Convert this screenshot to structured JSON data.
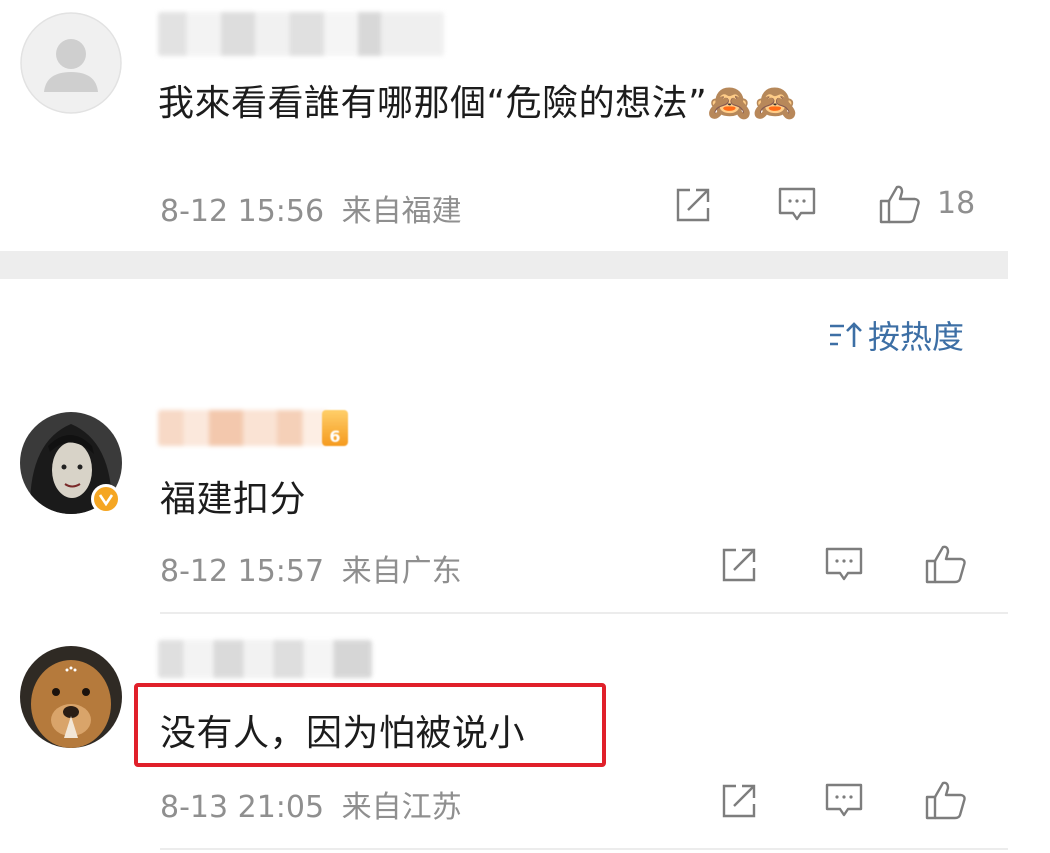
{
  "sort": {
    "label": "按热度"
  },
  "comments": [
    {
      "text": "我來看看誰有哪那個“危險的想法”🙈🙈",
      "time": "8-12 15:56",
      "location": "来自福建",
      "like_count": "18"
    },
    {
      "text": "福建扣分",
      "time": "8-12 15:57",
      "location": "来自广东",
      "like_count": ""
    },
    {
      "text": "没有人，因为怕被说小",
      "time": "8-13 21:05",
      "location": "来自江苏",
      "like_count": ""
    }
  ],
  "icons": {
    "share": "share-icon",
    "comment": "comment-icon",
    "like": "thumbs-up-icon",
    "sort": "sort-icon"
  },
  "colors": {
    "link_blue": "#3d6fa5",
    "meta_gray": "#8f8f8f",
    "highlight_red": "#e0202a",
    "verified_gold": "#f5a623"
  }
}
